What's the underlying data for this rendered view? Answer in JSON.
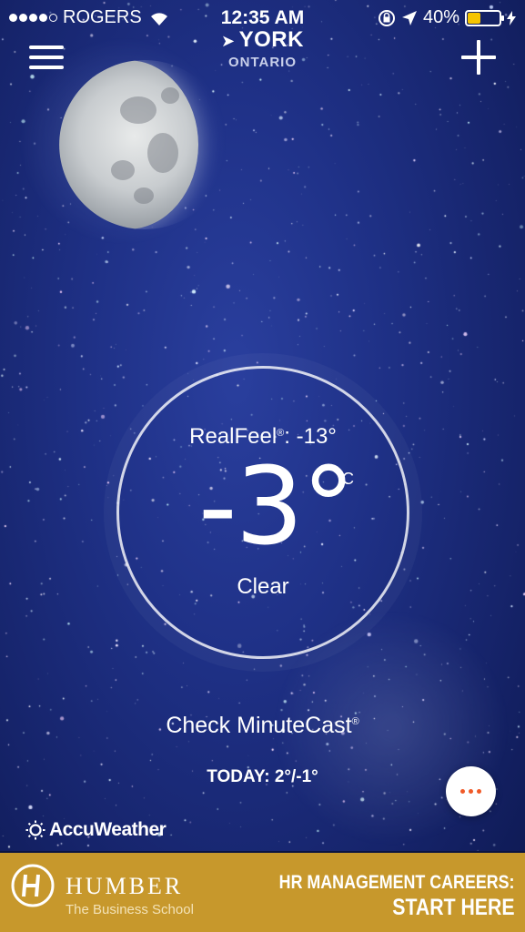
{
  "status_bar": {
    "carrier": "ROGERS",
    "time": "12:35 AM",
    "battery_percent_label": "40%",
    "battery_level": 0.4,
    "signal_bars_filled": 4,
    "signal_bars_total": 5
  },
  "header": {
    "city": "YORK",
    "region": "ONTARIO"
  },
  "current": {
    "realfeel_label": "RealFeel",
    "realfeel_mark": "®",
    "realfeel_value": ": -13°",
    "temperature": "-3°",
    "unit": "C",
    "condition": "Clear"
  },
  "minutecast": {
    "label": "Check MinuteCast",
    "mark": "®"
  },
  "today": "TODAY: 2°/-1°",
  "brand": "AccuWeather",
  "ad": {
    "name": "HUMBER",
    "subtitle": "The Business School",
    "cta_line1": "HR MANAGEMENT CAREERS:",
    "cta_line2": "START HERE"
  },
  "colors": {
    "sky": "#1f3187",
    "ad_background": "#c7982c",
    "battery": "#f5c400",
    "more_dots": "#f05a28"
  },
  "icons": [
    "location-arrow-icon",
    "menu-icon",
    "add-icon",
    "more-icon",
    "sun-icon",
    "wifi-icon",
    "rotation-lock-icon"
  ]
}
